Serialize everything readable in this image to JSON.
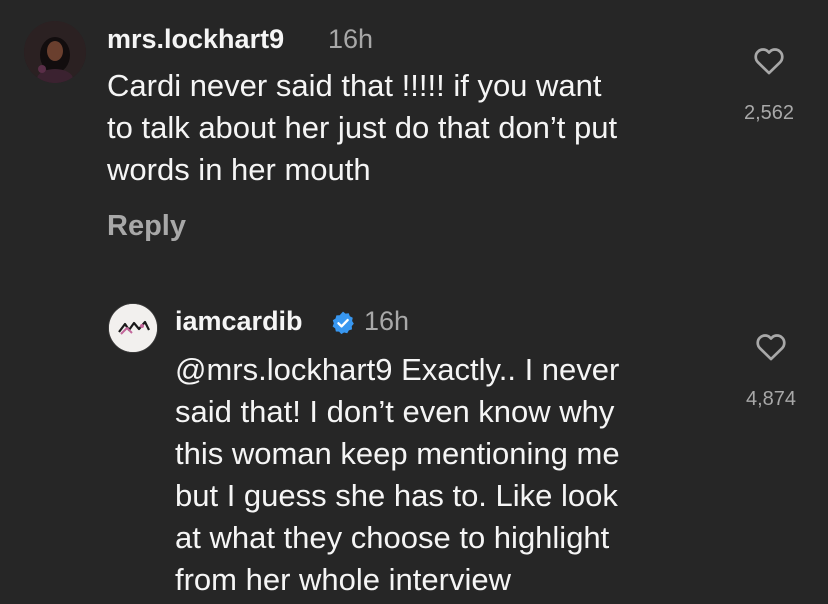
{
  "comments": [
    {
      "username": "mrs.lockhart9",
      "time": "16h",
      "lines": [
        "Cardi never said that !!!!! if you want",
        "to talk about her just do that don’t put",
        "words in her mouth"
      ],
      "reply_label": "Reply",
      "likes": "2,562",
      "verified": false
    },
    {
      "username": "iamcardib",
      "time": "16h",
      "lines": [
        "@mrs.lockhart9 Exactly.. I never",
        "said that! I don’t even know why",
        "this woman keep mentioning me",
        "but I guess she has to. Like look",
        "at what they choose to highlight",
        "from her whole interview"
      ],
      "likes": "4,874",
      "verified": true
    }
  ],
  "colors": {
    "background": "#262626",
    "primary_text": "#f5f5f5",
    "secondary_text": "#a8a8a8",
    "verified_badge": "#3897f0"
  },
  "icons": [
    "avatar",
    "heart-icon",
    "verified-badge-icon"
  ]
}
